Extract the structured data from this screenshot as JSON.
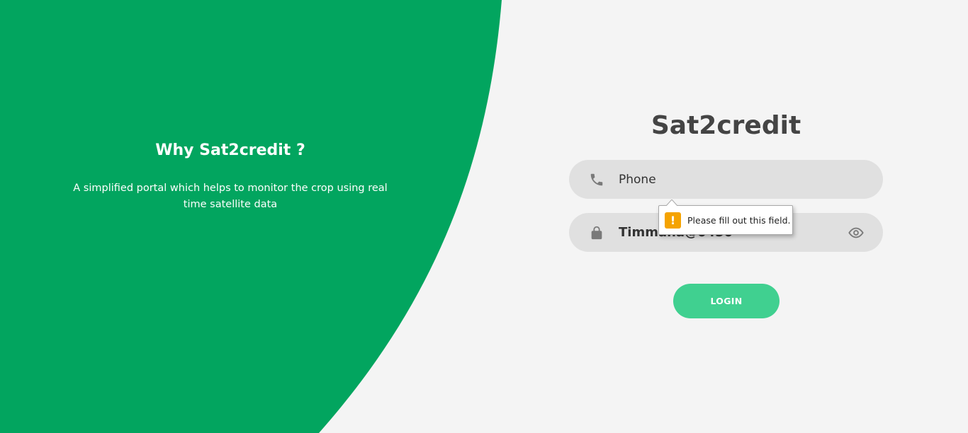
{
  "colors": {
    "green_panel": "#02a55f",
    "background": "#f4f4f4",
    "field_bg": "#e0e0e0",
    "button": "#40d090",
    "warning": "#f5a300"
  },
  "info": {
    "title": "Why Sat2credit ?",
    "description": "A simplified portal which helps to monitor the crop using real time satellite data"
  },
  "brand": {
    "title": "Sat2credit"
  },
  "form": {
    "phone": {
      "placeholder": "Phone",
      "value": "",
      "icon": "phone-icon"
    },
    "password": {
      "value": "Timmana@0450",
      "icon": "lock-icon",
      "toggle_icon": "eye-icon"
    },
    "login_label": "LOGIN"
  },
  "validation": {
    "message": "Please fill out this field.",
    "icon": "warning-icon"
  }
}
